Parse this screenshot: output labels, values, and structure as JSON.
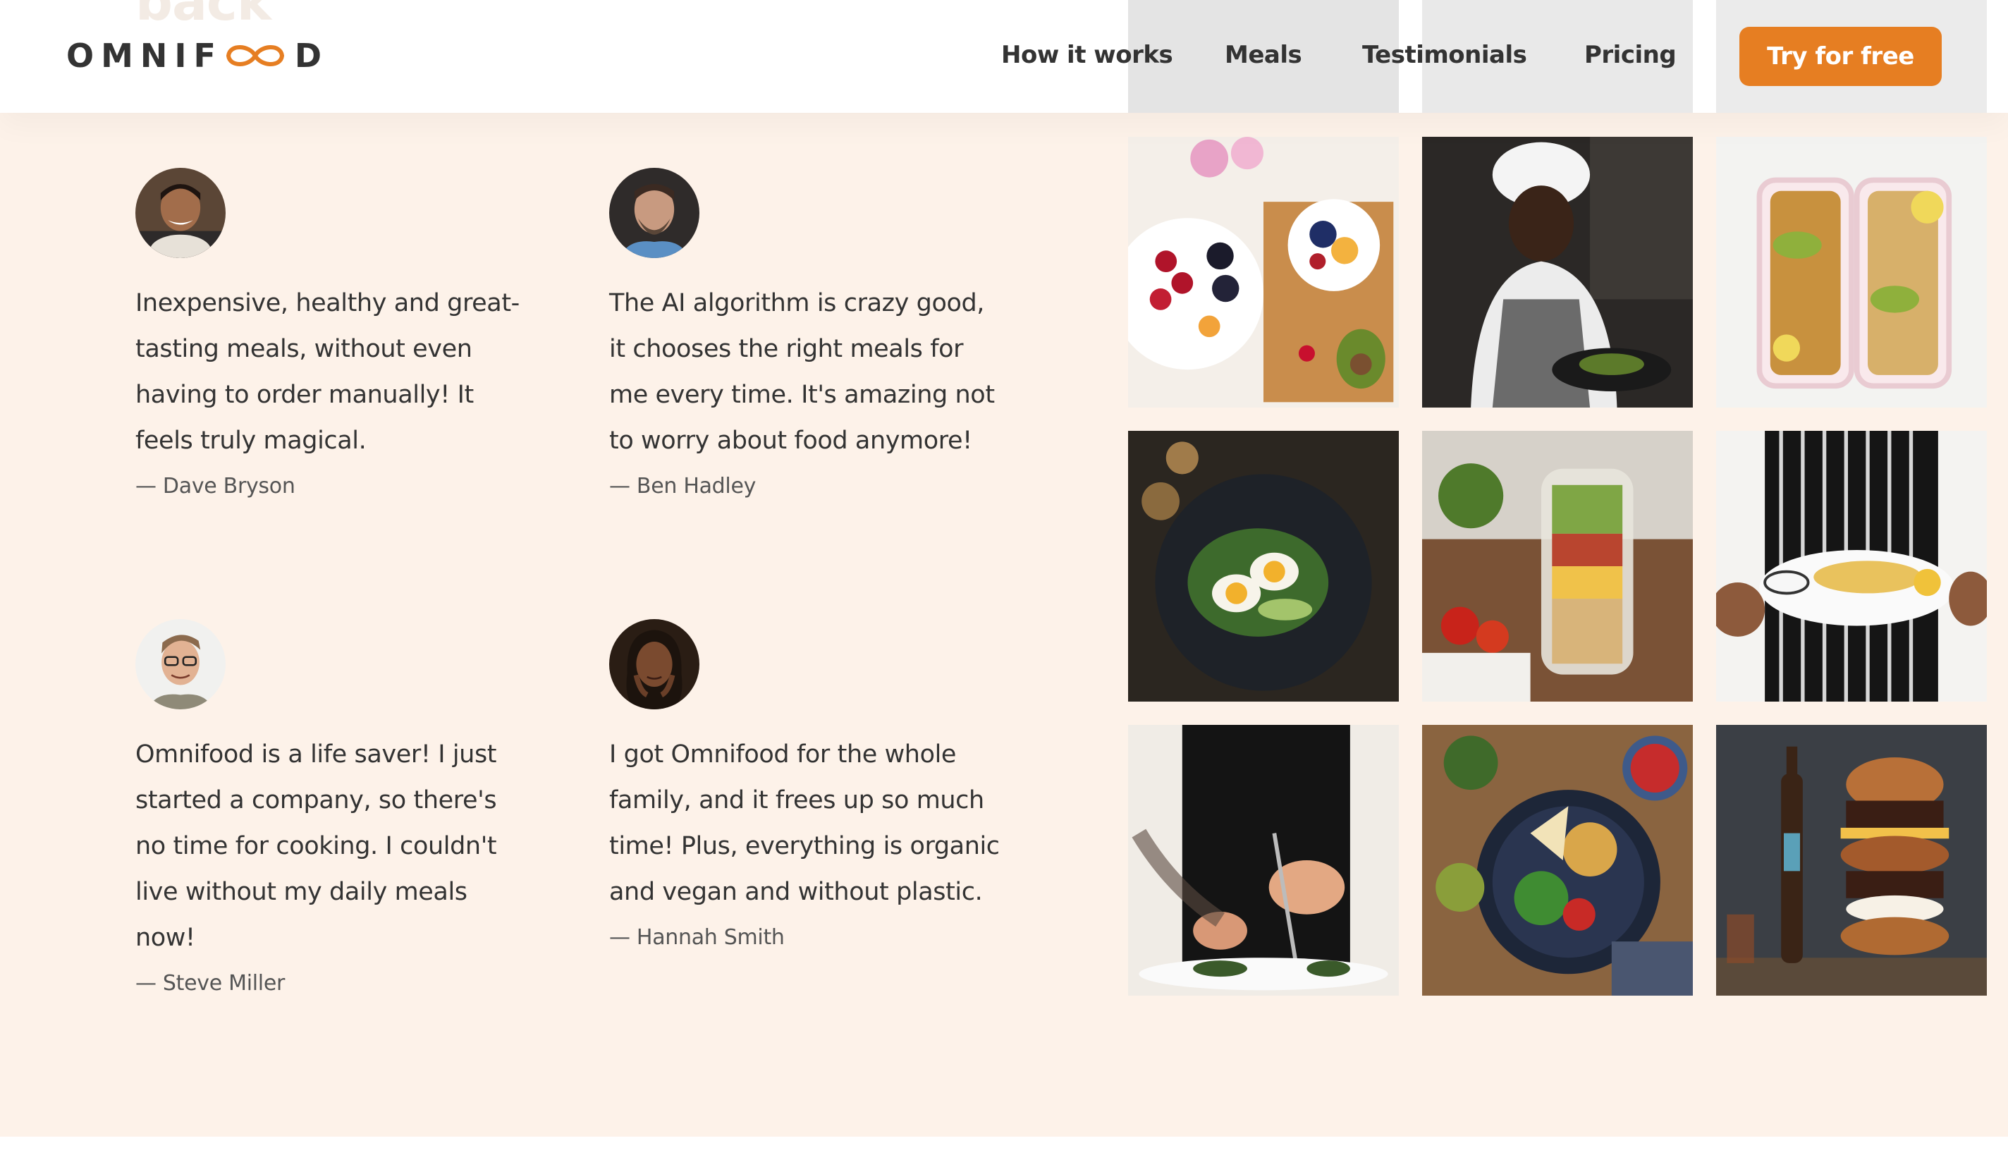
{
  "header": {
    "ghost_heading": "back",
    "logo": {
      "text_left": "OMNIF",
      "text_right": "D",
      "icon": "infinity-icon",
      "accent": "#e67e22"
    },
    "nav": [
      {
        "label": "How it works"
      },
      {
        "label": "Meals"
      },
      {
        "label": "Testimonials"
      },
      {
        "label": "Pricing"
      }
    ],
    "cta_label": "Try for free"
  },
  "colors": {
    "accent": "#e67e22",
    "section_bg": "#fdf2e9",
    "text": "#333333",
    "muted": "#555555"
  },
  "testimonials": [
    {
      "quote": "Inexpensive, healthy and great-tasting meals, without even having to order manually! It feels truly magical.",
      "author": "— Dave Bryson"
    },
    {
      "quote": "The AI algorithm is crazy good, it chooses the right meals for me every time. It's amazing not to worry about food anymore!",
      "author": "— Ben Hadley"
    },
    {
      "quote": "Omnifood is a life saver! I just started a company, so there's no time for cooking. I couldn't live without my daily meals now!",
      "author": "— Steve Miller"
    },
    {
      "quote": "I got Omnifood for the whole family, and it frees up so much time! Plus, everything is organic and vegan and without plastic.",
      "author": "— Hannah Smith"
    }
  ],
  "gallery": [
    {
      "name": "fruit-bowl-photo"
    },
    {
      "name": "chef-cooking-photo"
    },
    {
      "name": "meal-prep-boxes-photo"
    },
    {
      "name": "egg-salad-plate-photo"
    },
    {
      "name": "layered-jar-salad-photo"
    },
    {
      "name": "served-dish-photo"
    },
    {
      "name": "plating-chef-photo"
    },
    {
      "name": "chickpea-salad-bowl-photo"
    },
    {
      "name": "burger-stack-photo"
    }
  ]
}
